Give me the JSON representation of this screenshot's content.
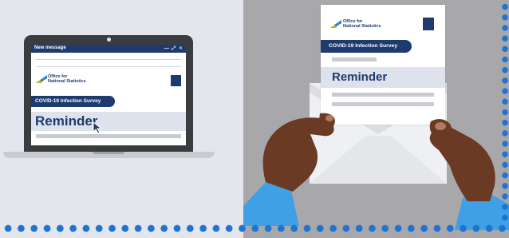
{
  "email": {
    "window_title": "New message",
    "window_controls": "— ⤢ ✕"
  },
  "logo": {
    "line1": "Office for",
    "line2": "National Statistics"
  },
  "survey_label": "COVID-19 Infection Survey",
  "reminder_text": "Reminder",
  "colors": {
    "navy": "#1d3b6e",
    "accent_blue": "#1f73d1",
    "sleeve": "#3fa0e6",
    "skin": "#6b3a24",
    "left_bg": "#e3e6ec",
    "right_bg": "#a8a8ab"
  },
  "icons": [
    "cursor-arrow-icon",
    "ons-logo-icon",
    "crest-icon"
  ]
}
